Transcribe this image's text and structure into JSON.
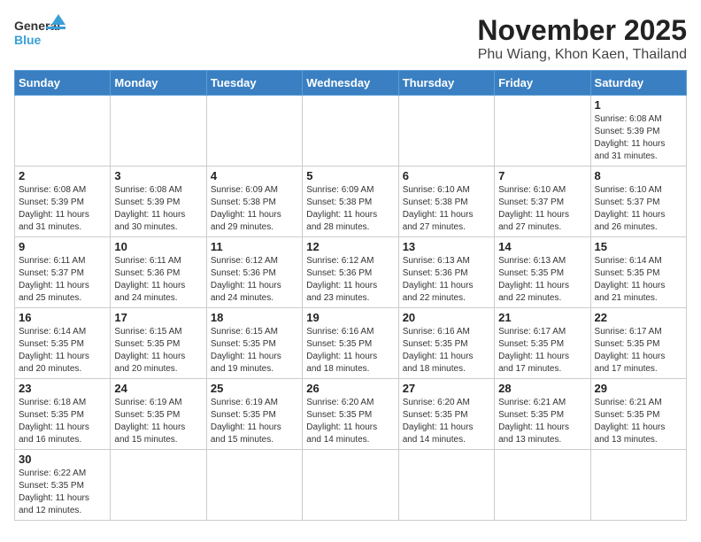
{
  "header": {
    "logo_general": "General",
    "logo_blue": "Blue",
    "month": "November 2025",
    "location": "Phu Wiang, Khon Kaen, Thailand"
  },
  "weekdays": [
    "Sunday",
    "Monday",
    "Tuesday",
    "Wednesday",
    "Thursday",
    "Friday",
    "Saturday"
  ],
  "weeks": [
    [
      {
        "day": "",
        "info": ""
      },
      {
        "day": "",
        "info": ""
      },
      {
        "day": "",
        "info": ""
      },
      {
        "day": "",
        "info": ""
      },
      {
        "day": "",
        "info": ""
      },
      {
        "day": "",
        "info": ""
      },
      {
        "day": "1",
        "info": "Sunrise: 6:08 AM\nSunset: 5:39 PM\nDaylight: 11 hours\nand 31 minutes."
      }
    ],
    [
      {
        "day": "2",
        "info": "Sunrise: 6:08 AM\nSunset: 5:39 PM\nDaylight: 11 hours\nand 31 minutes."
      },
      {
        "day": "3",
        "info": "Sunrise: 6:08 AM\nSunset: 5:39 PM\nDaylight: 11 hours\nand 30 minutes."
      },
      {
        "day": "4",
        "info": "Sunrise: 6:09 AM\nSunset: 5:38 PM\nDaylight: 11 hours\nand 29 minutes."
      },
      {
        "day": "5",
        "info": "Sunrise: 6:09 AM\nSunset: 5:38 PM\nDaylight: 11 hours\nand 28 minutes."
      },
      {
        "day": "6",
        "info": "Sunrise: 6:10 AM\nSunset: 5:38 PM\nDaylight: 11 hours\nand 27 minutes."
      },
      {
        "day": "7",
        "info": "Sunrise: 6:10 AM\nSunset: 5:37 PM\nDaylight: 11 hours\nand 27 minutes."
      },
      {
        "day": "8",
        "info": "Sunrise: 6:10 AM\nSunset: 5:37 PM\nDaylight: 11 hours\nand 26 minutes."
      }
    ],
    [
      {
        "day": "9",
        "info": "Sunrise: 6:11 AM\nSunset: 5:37 PM\nDaylight: 11 hours\nand 25 minutes."
      },
      {
        "day": "10",
        "info": "Sunrise: 6:11 AM\nSunset: 5:36 PM\nDaylight: 11 hours\nand 24 minutes."
      },
      {
        "day": "11",
        "info": "Sunrise: 6:12 AM\nSunset: 5:36 PM\nDaylight: 11 hours\nand 24 minutes."
      },
      {
        "day": "12",
        "info": "Sunrise: 6:12 AM\nSunset: 5:36 PM\nDaylight: 11 hours\nand 23 minutes."
      },
      {
        "day": "13",
        "info": "Sunrise: 6:13 AM\nSunset: 5:36 PM\nDaylight: 11 hours\nand 22 minutes."
      },
      {
        "day": "14",
        "info": "Sunrise: 6:13 AM\nSunset: 5:35 PM\nDaylight: 11 hours\nand 22 minutes."
      },
      {
        "day": "15",
        "info": "Sunrise: 6:14 AM\nSunset: 5:35 PM\nDaylight: 11 hours\nand 21 minutes."
      }
    ],
    [
      {
        "day": "16",
        "info": "Sunrise: 6:14 AM\nSunset: 5:35 PM\nDaylight: 11 hours\nand 20 minutes."
      },
      {
        "day": "17",
        "info": "Sunrise: 6:15 AM\nSunset: 5:35 PM\nDaylight: 11 hours\nand 20 minutes."
      },
      {
        "day": "18",
        "info": "Sunrise: 6:15 AM\nSunset: 5:35 PM\nDaylight: 11 hours\nand 19 minutes."
      },
      {
        "day": "19",
        "info": "Sunrise: 6:16 AM\nSunset: 5:35 PM\nDaylight: 11 hours\nand 18 minutes."
      },
      {
        "day": "20",
        "info": "Sunrise: 6:16 AM\nSunset: 5:35 PM\nDaylight: 11 hours\nand 18 minutes."
      },
      {
        "day": "21",
        "info": "Sunrise: 6:17 AM\nSunset: 5:35 PM\nDaylight: 11 hours\nand 17 minutes."
      },
      {
        "day": "22",
        "info": "Sunrise: 6:17 AM\nSunset: 5:35 PM\nDaylight: 11 hours\nand 17 minutes."
      }
    ],
    [
      {
        "day": "23",
        "info": "Sunrise: 6:18 AM\nSunset: 5:35 PM\nDaylight: 11 hours\nand 16 minutes."
      },
      {
        "day": "24",
        "info": "Sunrise: 6:19 AM\nSunset: 5:35 PM\nDaylight: 11 hours\nand 15 minutes."
      },
      {
        "day": "25",
        "info": "Sunrise: 6:19 AM\nSunset: 5:35 PM\nDaylight: 11 hours\nand 15 minutes."
      },
      {
        "day": "26",
        "info": "Sunrise: 6:20 AM\nSunset: 5:35 PM\nDaylight: 11 hours\nand 14 minutes."
      },
      {
        "day": "27",
        "info": "Sunrise: 6:20 AM\nSunset: 5:35 PM\nDaylight: 11 hours\nand 14 minutes."
      },
      {
        "day": "28",
        "info": "Sunrise: 6:21 AM\nSunset: 5:35 PM\nDaylight: 11 hours\nand 13 minutes."
      },
      {
        "day": "29",
        "info": "Sunrise: 6:21 AM\nSunset: 5:35 PM\nDaylight: 11 hours\nand 13 minutes."
      }
    ],
    [
      {
        "day": "30",
        "info": "Sunrise: 6:22 AM\nSunset: 5:35 PM\nDaylight: 11 hours\nand 12 minutes."
      },
      {
        "day": "",
        "info": ""
      },
      {
        "day": "",
        "info": ""
      },
      {
        "day": "",
        "info": ""
      },
      {
        "day": "",
        "info": ""
      },
      {
        "day": "",
        "info": ""
      },
      {
        "day": "",
        "info": ""
      }
    ]
  ]
}
